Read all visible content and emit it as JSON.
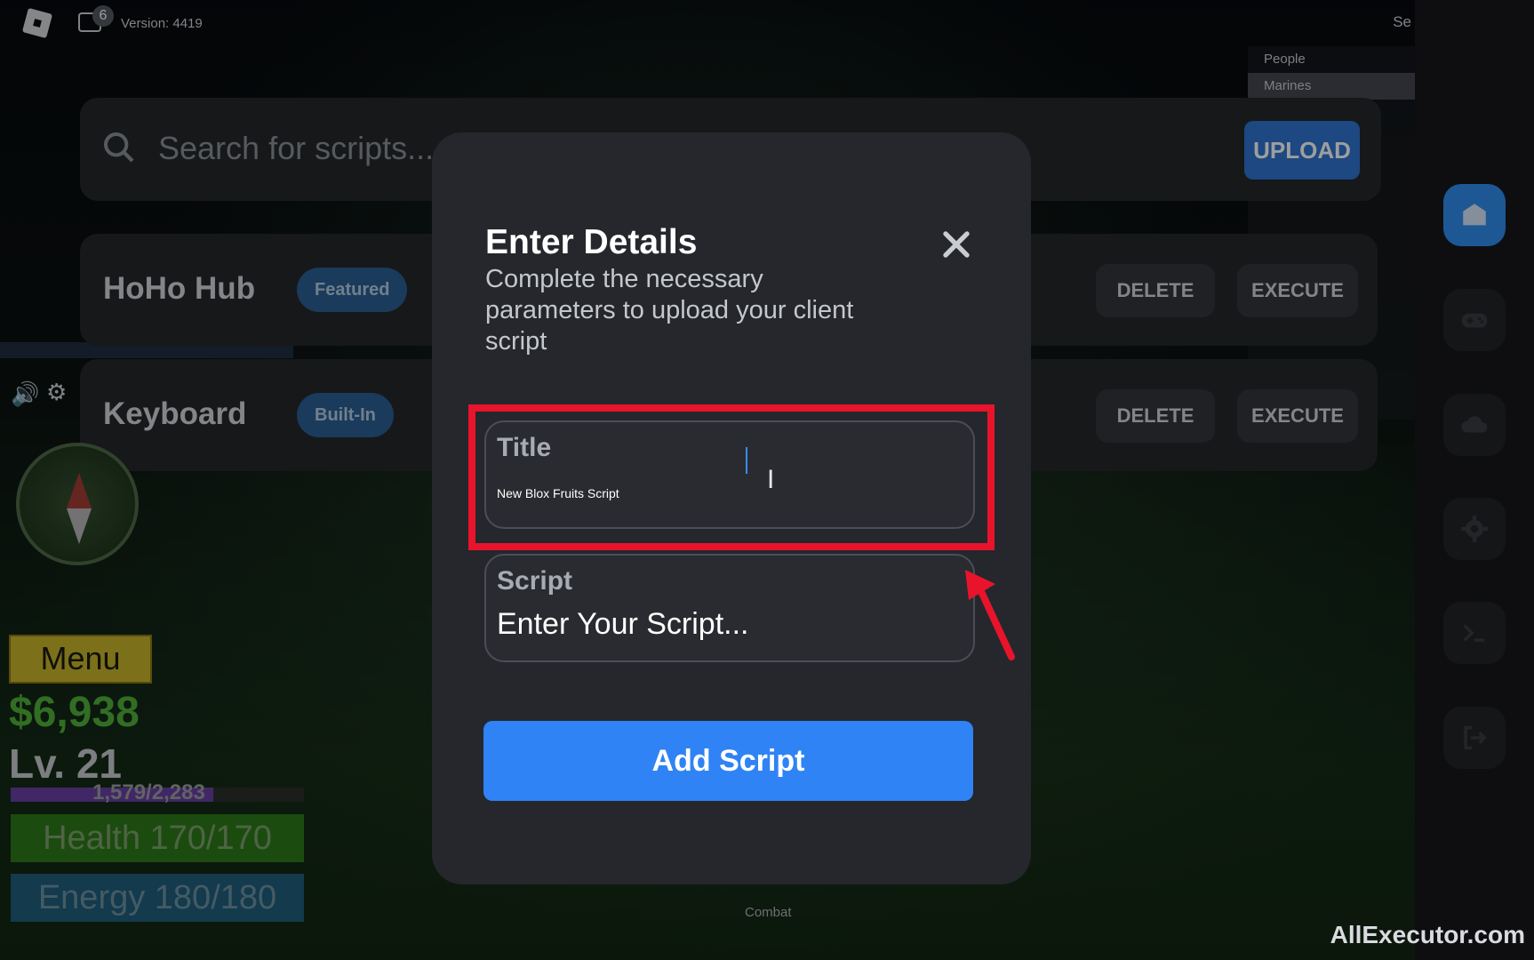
{
  "topbar": {
    "chat_badge_count": "6",
    "version": "Version: 4419",
    "right_label": "Se"
  },
  "people_panel": {
    "header": "People",
    "selected_team": "Marines"
  },
  "search": {
    "placeholder": "Search for scripts..."
  },
  "upload_label": "UPLOAD",
  "scripts": [
    {
      "title": "HoHo Hub",
      "badge": "Featured",
      "delete_label": "DELETE",
      "execute_label": "EXECUTE"
    },
    {
      "title": "Keyboard",
      "badge": "Built-In",
      "delete_label": "DELETE",
      "execute_label": "EXECUTE"
    }
  ],
  "sidebar": {
    "items": [
      {
        "icon": "home-icon",
        "active": true
      },
      {
        "icon": "gamepad-icon",
        "active": false
      },
      {
        "icon": "cloud-icon",
        "active": false
      },
      {
        "icon": "gear-icon",
        "active": false
      },
      {
        "icon": "terminal-icon",
        "active": false
      },
      {
        "icon": "logout-icon",
        "active": false
      }
    ],
    "active_color": "#2f8ff0"
  },
  "hud": {
    "menu_label": "Menu",
    "money": "$6,938",
    "level": "Lv. 21",
    "xp_text": "1,579/2,283",
    "xp_fraction": 0.69,
    "health": "Health 170/170",
    "energy": "Energy 180/180",
    "hotbar_label": "Combat"
  },
  "modal": {
    "title": "Enter Details",
    "subtitle": "Complete the necessary parameters to upload your client script",
    "title_field_label": "Title",
    "title_field_value": "New Blox Fruits Script",
    "script_field_label": "Script",
    "script_field_placeholder": "Enter Your Script...",
    "submit_label": "Add Script",
    "accent_color": "#2f83f5",
    "highlight_color": "#e8142c"
  },
  "watermark": "AllExecutor.com"
}
